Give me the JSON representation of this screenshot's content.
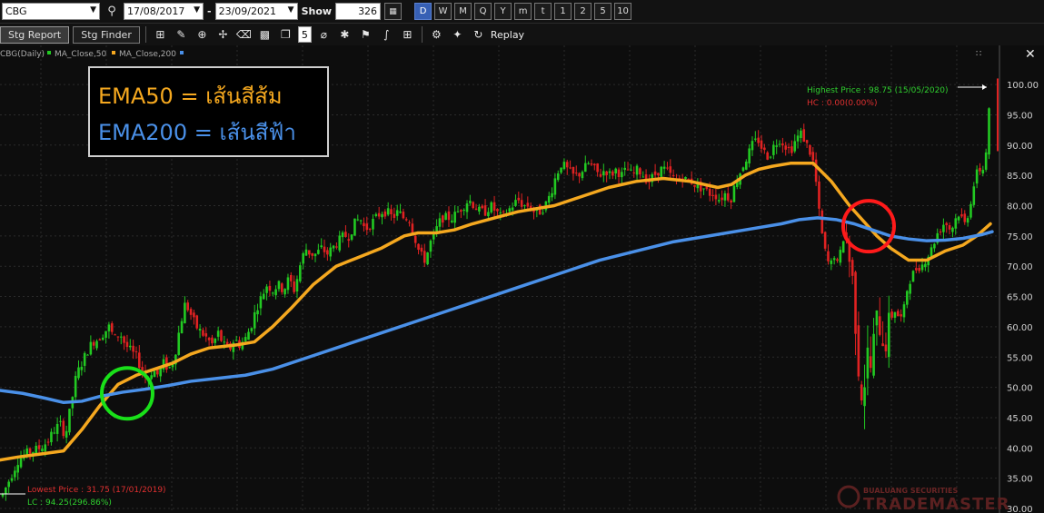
{
  "toolbar": {
    "symbol": "CBG",
    "date_from": "17/08/2017",
    "date_to": "23/09/2021",
    "dash": "-",
    "show_label": "Show",
    "show_value": "326",
    "periods": [
      "D",
      "W",
      "M",
      "Q",
      "Y",
      "m",
      "t",
      "1",
      "2",
      "5",
      "10"
    ],
    "active_period": "D"
  },
  "toolbar2": {
    "stg_report": "Stg Report",
    "stg_finder": "Stg Finder",
    "count": "5",
    "replay": "Replay"
  },
  "legend": {
    "symbol": "CBG(Daily)",
    "ma50": "MA_Close,50",
    "ma200": "MA_Close,200"
  },
  "annotation": {
    "line1": "EMA50 = เส้นสีส้ม",
    "line2": "EMA200 = เส้นสีฟ้า"
  },
  "close_label": "✕",
  "watermark": {
    "line1": "BUALUANG SECURITIES",
    "line2": "TRADEMASTER"
  },
  "colors": {
    "ema50": "#f5a81f",
    "ema200": "#4a90e8",
    "up": "#22c922",
    "down": "#e02222",
    "grid": "#2b2b2b",
    "green_circle": "#19e019",
    "red_circle": "#ff1a1a"
  },
  "chart_data": {
    "type": "line",
    "ylim": [
      29,
      104
    ],
    "yticks": [
      "30.00",
      "35.00",
      "40.00",
      "45.00",
      "50.00",
      "55.00",
      "60.00",
      "65.00",
      "70.00",
      "75.00",
      "80.00",
      "85.00",
      "90.00",
      "95.00",
      "100.00"
    ],
    "ytick_values": [
      30,
      35,
      40,
      45,
      50,
      55,
      60,
      65,
      70,
      75,
      80,
      85,
      90,
      95,
      100
    ],
    "highest_label": "Highest Price : 98.75 (15/05/2020)",
    "hc_label": "HC : 0.00(0.00%)",
    "lowest_label": "Lowest Price : 31.75 (17/01/2019)",
    "lc_label": "LC : 94.25(296.86%)",
    "n_bars": 326,
    "series": [
      {
        "name": "MA_Close,50",
        "color": "#f5a81f",
        "points": [
          [
            0,
            38
          ],
          [
            20,
            38.5
          ],
          [
            45,
            39
          ],
          [
            70,
            39.5
          ],
          [
            90,
            43
          ],
          [
            110,
            47
          ],
          [
            130,
            50.5
          ],
          [
            150,
            52
          ],
          [
            170,
            53
          ],
          [
            190,
            54
          ],
          [
            210,
            55.5
          ],
          [
            230,
            56.5
          ],
          [
            260,
            57
          ],
          [
            280,
            57.5
          ],
          [
            300,
            60
          ],
          [
            320,
            63
          ],
          [
            345,
            67
          ],
          [
            370,
            70
          ],
          [
            395,
            71.5
          ],
          [
            420,
            73
          ],
          [
            445,
            75
          ],
          [
            460,
            75.5
          ],
          [
            480,
            75.5
          ],
          [
            500,
            76
          ],
          [
            520,
            77
          ],
          [
            545,
            78
          ],
          [
            570,
            79
          ],
          [
            590,
            79.5
          ],
          [
            610,
            80
          ],
          [
            640,
            81.5
          ],
          [
            670,
            83
          ],
          [
            700,
            84
          ],
          [
            730,
            84.5
          ],
          [
            760,
            84
          ],
          [
            790,
            83
          ],
          [
            805,
            83.5
          ],
          [
            820,
            85
          ],
          [
            835,
            86
          ],
          [
            850,
            86.5
          ],
          [
            870,
            87
          ],
          [
            895,
            87
          ],
          [
            915,
            84
          ],
          [
            935,
            80
          ],
          [
            950,
            77.5
          ],
          [
            965,
            75
          ],
          [
            980,
            73
          ],
          [
            1000,
            71
          ],
          [
            1020,
            71
          ],
          [
            1040,
            72.5
          ],
          [
            1060,
            73.5
          ],
          [
            1075,
            75
          ],
          [
            1090,
            77
          ]
        ]
      },
      {
        "name": "MA_Close,200",
        "color": "#4a90e8",
        "points": [
          [
            0,
            49.5
          ],
          [
            25,
            49
          ],
          [
            50,
            48.2
          ],
          [
            70,
            47.5
          ],
          [
            90,
            47.7
          ],
          [
            110,
            48.5
          ],
          [
            135,
            49.2
          ],
          [
            160,
            49.7
          ],
          [
            185,
            50.3
          ],
          [
            210,
            51
          ],
          [
            240,
            51.5
          ],
          [
            270,
            52
          ],
          [
            300,
            53
          ],
          [
            340,
            55
          ],
          [
            380,
            57
          ],
          [
            420,
            59
          ],
          [
            460,
            61
          ],
          [
            500,
            63
          ],
          [
            540,
            65
          ],
          [
            580,
            67
          ],
          [
            620,
            69
          ],
          [
            660,
            71
          ],
          [
            700,
            72.5
          ],
          [
            740,
            74
          ],
          [
            780,
            75
          ],
          [
            820,
            76
          ],
          [
            860,
            77
          ],
          [
            880,
            77.7
          ],
          [
            900,
            78
          ],
          [
            920,
            77.7
          ],
          [
            940,
            77
          ],
          [
            960,
            76
          ],
          [
            980,
            75
          ],
          [
            1000,
            74.5
          ],
          [
            1020,
            74.2
          ],
          [
            1040,
            74.3
          ],
          [
            1060,
            74.6
          ],
          [
            1080,
            75.2
          ],
          [
            1092,
            75.7
          ]
        ]
      }
    ],
    "price_path": [
      [
        2,
        32
      ],
      [
        8,
        34
      ],
      [
        14,
        36
      ],
      [
        20,
        38
      ],
      [
        28,
        39
      ],
      [
        36,
        39.5
      ],
      [
        44,
        40
      ],
      [
        52,
        41
      ],
      [
        60,
        43
      ],
      [
        66,
        44
      ],
      [
        72,
        42
      ],
      [
        78,
        47
      ],
      [
        84,
        52
      ],
      [
        90,
        54
      ],
      [
        96,
        56
      ],
      [
        102,
        57.5
      ],
      [
        108,
        58
      ],
      [
        114,
        59
      ],
      [
        120,
        60
      ],
      [
        126,
        58
      ],
      [
        132,
        59
      ],
      [
        138,
        57
      ],
      [
        144,
        56
      ],
      [
        150,
        55
      ],
      [
        156,
        53
      ],
      [
        162,
        51
      ],
      [
        168,
        53
      ],
      [
        174,
        52
      ],
      [
        180,
        54
      ],
      [
        186,
        53
      ],
      [
        192,
        55
      ],
      [
        198,
        60
      ],
      [
        204,
        64
      ],
      [
        210,
        62
      ],
      [
        216,
        60
      ],
      [
        222,
        59
      ],
      [
        228,
        58
      ],
      [
        234,
        57
      ],
      [
        240,
        59
      ],
      [
        246,
        57
      ],
      [
        252,
        56
      ],
      [
        258,
        58
      ],
      [
        264,
        57
      ],
      [
        270,
        58
      ],
      [
        276,
        60
      ],
      [
        282,
        63
      ],
      [
        288,
        65
      ],
      [
        294,
        67
      ],
      [
        300,
        66
      ],
      [
        306,
        67
      ],
      [
        312,
        66
      ],
      [
        318,
        68
      ],
      [
        324,
        66
      ],
      [
        330,
        70
      ],
      [
        336,
        73
      ],
      [
        342,
        72
      ],
      [
        348,
        72
      ],
      [
        354,
        73
      ],
      [
        360,
        72
      ],
      [
        366,
        73
      ],
      [
        372,
        74
      ],
      [
        378,
        75
      ],
      [
        384,
        75
      ],
      [
        390,
        77
      ],
      [
        396,
        78
      ],
      [
        402,
        76
      ],
      [
        408,
        77
      ],
      [
        414,
        78
      ],
      [
        420,
        79
      ],
      [
        426,
        79
      ],
      [
        432,
        78
      ],
      [
        438,
        79
      ],
      [
        444,
        78
      ],
      [
        450,
        78
      ],
      [
        456,
        75
      ],
      [
        462,
        72
      ],
      [
        468,
        71
      ],
      [
        474,
        74
      ],
      [
        480,
        76
      ],
      [
        486,
        78
      ],
      [
        492,
        78
      ],
      [
        498,
        78
      ],
      [
        504,
        79
      ],
      [
        510,
        80
      ],
      [
        516,
        81
      ],
      [
        522,
        80
      ],
      [
        528,
        79
      ],
      [
        534,
        79
      ],
      [
        540,
        80
      ],
      [
        546,
        79
      ],
      [
        552,
        78
      ],
      [
        558,
        79
      ],
      [
        564,
        80
      ],
      [
        570,
        81
      ],
      [
        576,
        80
      ],
      [
        582,
        80
      ],
      [
        588,
        79
      ],
      [
        594,
        79
      ],
      [
        600,
        80
      ],
      [
        606,
        82
      ],
      [
        612,
        85
      ],
      [
        618,
        87
      ],
      [
        624,
        86
      ],
      [
        630,
        85
      ],
      [
        636,
        85
      ],
      [
        642,
        86
      ],
      [
        648,
        87
      ],
      [
        654,
        86
      ],
      [
        660,
        85
      ],
      [
        666,
        86
      ],
      [
        672,
        85
      ],
      [
        678,
        86
      ],
      [
        684,
        85
      ],
      [
        690,
        86
      ],
      [
        696,
        85
      ],
      [
        702,
        86
      ],
      [
        708,
        85
      ],
      [
        714,
        84
      ],
      [
        720,
        85
      ],
      [
        726,
        86
      ],
      [
        732,
        86
      ],
      [
        738,
        85
      ],
      [
        744,
        84
      ],
      [
        750,
        85
      ],
      [
        756,
        84
      ],
      [
        762,
        84
      ],
      [
        768,
        83
      ],
      [
        774,
        83
      ],
      [
        780,
        82
      ],
      [
        786,
        82
      ],
      [
        792,
        81
      ],
      [
        798,
        82
      ],
      [
        804,
        81
      ],
      [
        810,
        84
      ],
      [
        816,
        86
      ],
      [
        822,
        88
      ],
      [
        828,
        90
      ],
      [
        834,
        91
      ],
      [
        840,
        89
      ],
      [
        846,
        88
      ],
      [
        852,
        90
      ],
      [
        858,
        91
      ],
      [
        864,
        90
      ],
      [
        870,
        89
      ],
      [
        876,
        91
      ],
      [
        882,
        92
      ],
      [
        888,
        90
      ],
      [
        894,
        88
      ],
      [
        898,
        84
      ],
      [
        902,
        78
      ],
      [
        906,
        74
      ],
      [
        910,
        71
      ],
      [
        914,
        70
      ],
      [
        918,
        72
      ],
      [
        922,
        70
      ],
      [
        926,
        73
      ],
      [
        930,
        76
      ],
      [
        934,
        72
      ],
      [
        938,
        68
      ],
      [
        942,
        60
      ],
      [
        946,
        51
      ],
      [
        950,
        48
      ],
      [
        954,
        56
      ],
      [
        958,
        53
      ],
      [
        962,
        58
      ],
      [
        966,
        62
      ],
      [
        970,
        59
      ],
      [
        974,
        57
      ],
      [
        978,
        60
      ],
      [
        982,
        62
      ],
      [
        986,
        63
      ],
      [
        990,
        61
      ],
      [
        994,
        62
      ],
      [
        998,
        66
      ],
      [
        1002,
        68
      ],
      [
        1006,
        69
      ],
      [
        1010,
        70
      ],
      [
        1014,
        70
      ],
      [
        1018,
        71
      ],
      [
        1022,
        72
      ],
      [
        1026,
        73
      ],
      [
        1030,
        75
      ],
      [
        1034,
        76
      ],
      [
        1038,
        77
      ],
      [
        1042,
        77
      ],
      [
        1046,
        76
      ],
      [
        1050,
        77
      ],
      [
        1054,
        79
      ],
      [
        1058,
        78
      ],
      [
        1062,
        77
      ],
      [
        1066,
        79
      ],
      [
        1070,
        82
      ],
      [
        1074,
        85
      ],
      [
        1078,
        86
      ],
      [
        1082,
        86
      ],
      [
        1086,
        90
      ],
      [
        1090,
        98.75
      ]
    ]
  }
}
